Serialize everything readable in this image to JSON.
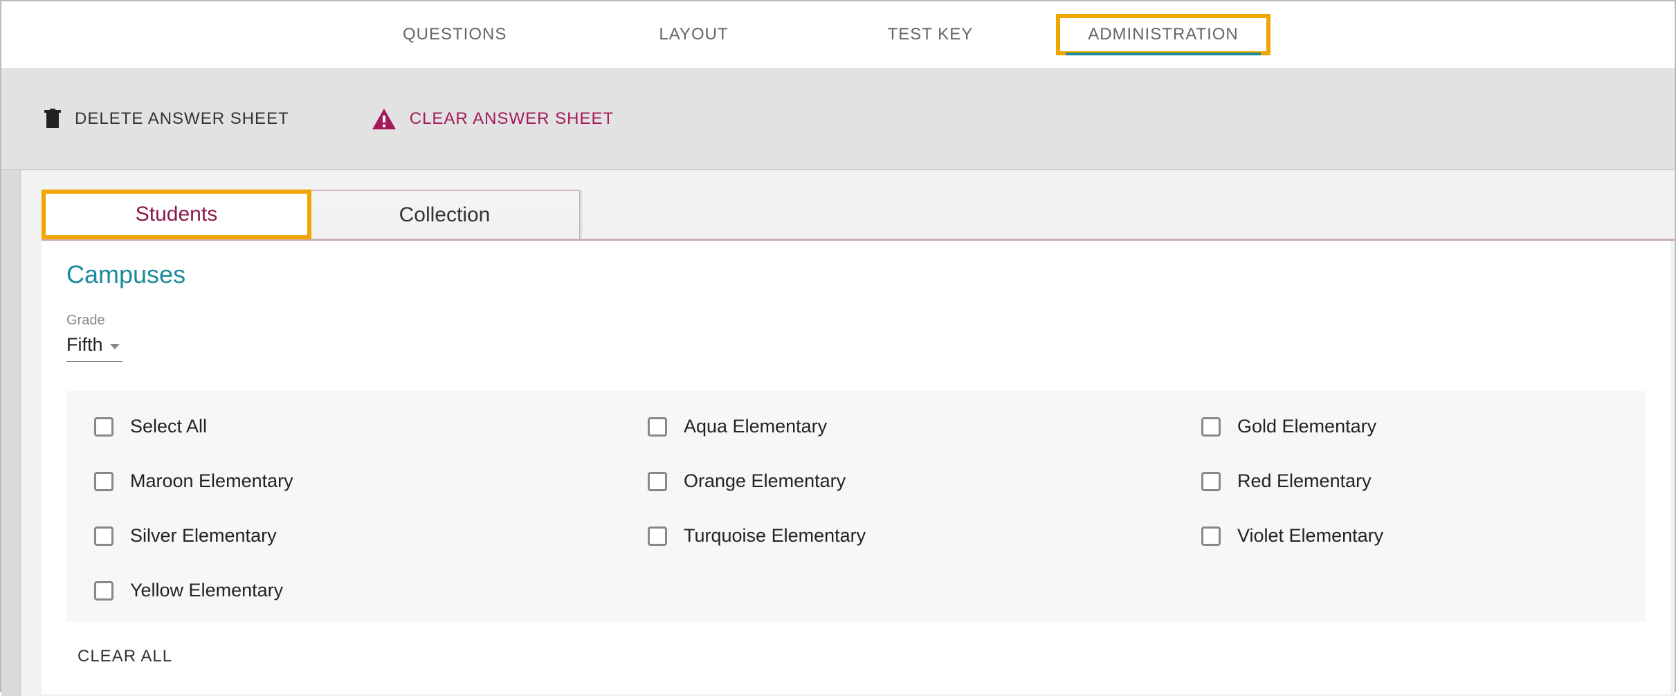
{
  "topnav": {
    "questions": "QUESTIONS",
    "layout": "LAYOUT",
    "testkey": "TEST KEY",
    "administration": "ADMINISTRATION"
  },
  "actions": {
    "delete": "DELETE ANSWER SHEET",
    "clear": "CLEAR ANSWER SHEET"
  },
  "subtabs": {
    "students": "Students",
    "collection": "Collection"
  },
  "panel": {
    "title": "Campuses",
    "grade_label": "Grade",
    "grade_value": "Fifth",
    "clear_all": "CLEAR ALL"
  },
  "campuses": {
    "row0": {
      "c0": "Select All",
      "c1": "Aqua Elementary",
      "c2": "Gold Elementary"
    },
    "row1": {
      "c0": "Maroon Elementary",
      "c1": "Orange Elementary",
      "c2": "Red Elementary"
    },
    "row2": {
      "c0": "Silver Elementary",
      "c1": "Turquoise Elementary",
      "c2": "Violet Elementary"
    },
    "row3": {
      "c0": "Yellow Elementary"
    }
  }
}
